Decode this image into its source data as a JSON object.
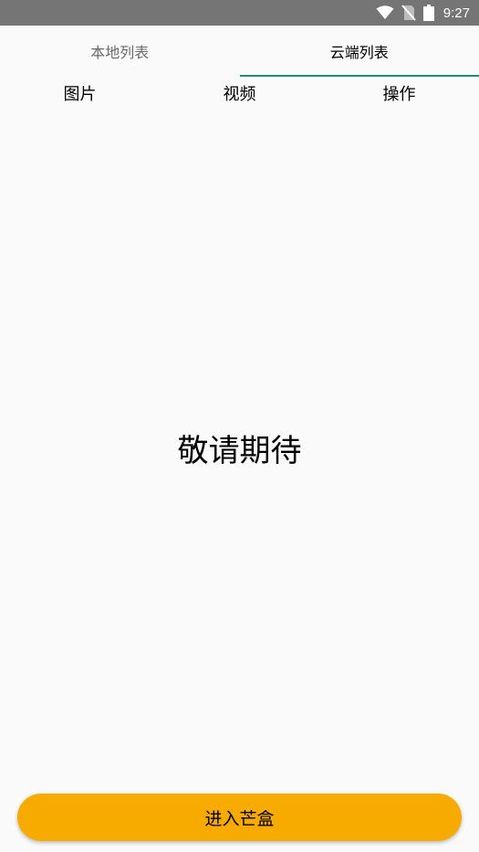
{
  "status_bar": {
    "time": "9:27",
    "icons": [
      "wifi-icon",
      "no-sim-icon",
      "battery-icon"
    ]
  },
  "tabs": [
    {
      "label": "本地列表",
      "active": false
    },
    {
      "label": "云端列表",
      "active": true
    }
  ],
  "columns": [
    "图片",
    "视频",
    "操作"
  ],
  "content": {
    "placeholder": "敬请期待"
  },
  "footer": {
    "button_label": "进入芒盒"
  },
  "colors": {
    "status_bar": "#757575",
    "accent": "#1a8f7a",
    "button": "#f7ab00",
    "background": "#fafafa"
  }
}
